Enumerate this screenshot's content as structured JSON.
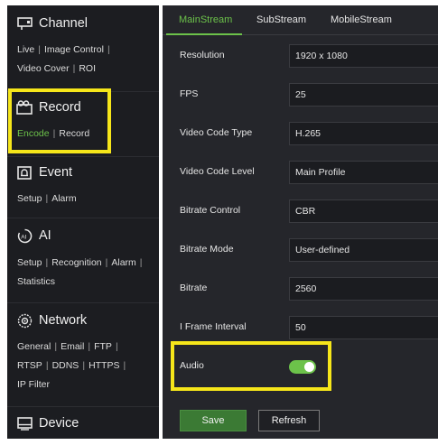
{
  "sidebar": {
    "channel": {
      "title": "Channel",
      "icon": "monitor-icon",
      "links": [
        "Live",
        "Image Control",
        "Video Cover",
        "ROI"
      ]
    },
    "record": {
      "title": "Record",
      "icon": "camera-icon",
      "links": [
        "Encode",
        "Record"
      ],
      "active_link": "Encode"
    },
    "event": {
      "title": "Event",
      "icon": "alarm-icon",
      "links": [
        "Setup",
        "Alarm"
      ]
    },
    "ai": {
      "title": "AI",
      "icon": "ai-icon",
      "links": [
        "Setup",
        "Recognition",
        "Alarm",
        "Statistics"
      ]
    },
    "network": {
      "title": "Network",
      "icon": "network-icon",
      "links": [
        "General",
        "Email",
        "FTP",
        "RTSP",
        "DDNS",
        "HTTPS",
        "IP Filter"
      ]
    },
    "device": {
      "title": "Device",
      "icon": "device-icon"
    }
  },
  "tabs": [
    "MainStream",
    "SubStream",
    "MobileStream"
  ],
  "active_tab": "MainStream",
  "form": [
    {
      "label": "Resolution",
      "value": "1920 x 1080"
    },
    {
      "label": "FPS",
      "value": "25"
    },
    {
      "label": "Video Code Type",
      "value": "H.265"
    },
    {
      "label": "Video Code Level",
      "value": "Main Profile"
    },
    {
      "label": "Bitrate Control",
      "value": "CBR"
    },
    {
      "label": "Bitrate Mode",
      "value": "User-defined"
    },
    {
      "label": "Bitrate",
      "value": "2560"
    },
    {
      "label": "I Frame Interval",
      "value": "50"
    }
  ],
  "audio": {
    "label": "Audio",
    "enabled": true
  },
  "buttons": {
    "save": "Save",
    "refresh": "Refresh"
  },
  "colors": {
    "accent": "#6cc24a",
    "highlight": "#f6e61a",
    "sidebar_bg": "#1c1d21",
    "panel_bg": "#25262b"
  }
}
